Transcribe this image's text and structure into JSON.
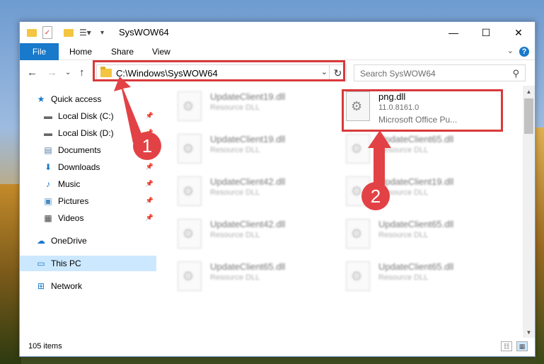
{
  "window": {
    "title": "SysWOW64"
  },
  "ribbon": {
    "tabs": [
      "File",
      "Home",
      "Share",
      "View"
    ]
  },
  "address": {
    "path": "C:\\Windows\\SysWOW64",
    "search_placeholder": "Search SysWOW64"
  },
  "nav": {
    "items": [
      {
        "label": "Quick access",
        "icon": "star-icon"
      },
      {
        "label": "Local Disk (C:)",
        "icon": "drive-icon",
        "pinned": true
      },
      {
        "label": "Local Disk (D:)",
        "icon": "drive-icon",
        "pinned": true
      },
      {
        "label": "Documents",
        "icon": "documents-icon",
        "pinned": true
      },
      {
        "label": "Downloads",
        "icon": "downloads-icon",
        "pinned": true
      },
      {
        "label": "Music",
        "icon": "music-icon",
        "pinned": true
      },
      {
        "label": "Pictures",
        "icon": "pictures-icon",
        "pinned": true
      },
      {
        "label": "Videos",
        "icon": "videos-icon",
        "pinned": true
      },
      {
        "label": "OneDrive",
        "icon": "cloud-icon"
      },
      {
        "label": "This PC",
        "icon": "computer-icon",
        "selected": true
      },
      {
        "label": "Network",
        "icon": "network-icon"
      }
    ]
  },
  "files": {
    "highlighted": {
      "name": "png.dll",
      "version": "11.0.8161.0",
      "description": "Microsoft Office Pu..."
    },
    "left_column": [
      {
        "name": "UpdateClient19.dll",
        "type": "Resource DLL"
      },
      {
        "name": "UpdateClient19.dll",
        "type": "Resource DLL"
      },
      {
        "name": "UpdateClient42.dll",
        "type": "Resource DLL"
      },
      {
        "name": "UpdateClient42.dll",
        "type": "Resource DLL"
      },
      {
        "name": "UpdateClient65.dll",
        "type": "Resource DLL"
      }
    ],
    "right_column": [
      {
        "name": "UpdateClient65.dll",
        "type": "Resource DLL"
      },
      {
        "name": "UpdateClient19.dll",
        "type": "Resource DLL"
      },
      {
        "name": "UpdateClient65.dll",
        "type": "Resource DLL"
      },
      {
        "name": "UpdateClient65.dll",
        "type": "Resource DLL"
      }
    ]
  },
  "status": {
    "item_count": "105 items"
  },
  "callouts": [
    "1",
    "2"
  ],
  "colors": {
    "accent": "#1979ca",
    "highlight": "#d9393b",
    "selected_nav": "#cce8ff"
  }
}
